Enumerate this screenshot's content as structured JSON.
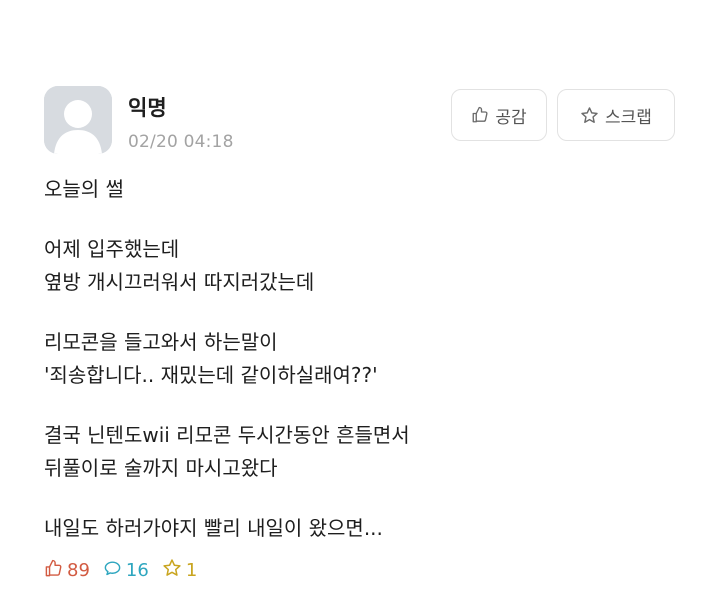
{
  "post": {
    "author": "익명",
    "time": "02/20 04:18",
    "content": {
      "title_line": "오늘의 썰",
      "paragraphs": [
        [
          "어제 입주했는데",
          "옆방 개시끄러워서 따지러갔는데"
        ],
        [
          "리모콘을 들고와서 하는말이",
          "'죄송합니다.. 재밌는데 같이하실래여??'"
        ],
        [
          "결국 닌텐도wii 리모콘 두시간동안 흔들면서",
          "뒤풀이로 술까지 마시고왔다"
        ],
        [
          "내일도 하러가야지 빨리 내일이 왔으면..."
        ]
      ]
    }
  },
  "buttons": {
    "like_label": "공감",
    "scrap_label": "스크랩"
  },
  "stats": {
    "likes": "89",
    "comments": "16",
    "scraps": "1"
  },
  "colors": {
    "like": "#d25b42",
    "comment": "#2ea6bf",
    "scrap": "#c9a520",
    "time": "#a3a3a3",
    "avatar_bg": "#d7dbe0"
  },
  "icons": {
    "avatar": "default-user-avatar-icon",
    "like_button": "thumbs-up-icon",
    "scrap_button": "star-icon",
    "like_stat": "thumbs-up-icon",
    "comment_stat": "speech-bubble-icon",
    "scrap_stat": "star-icon"
  }
}
